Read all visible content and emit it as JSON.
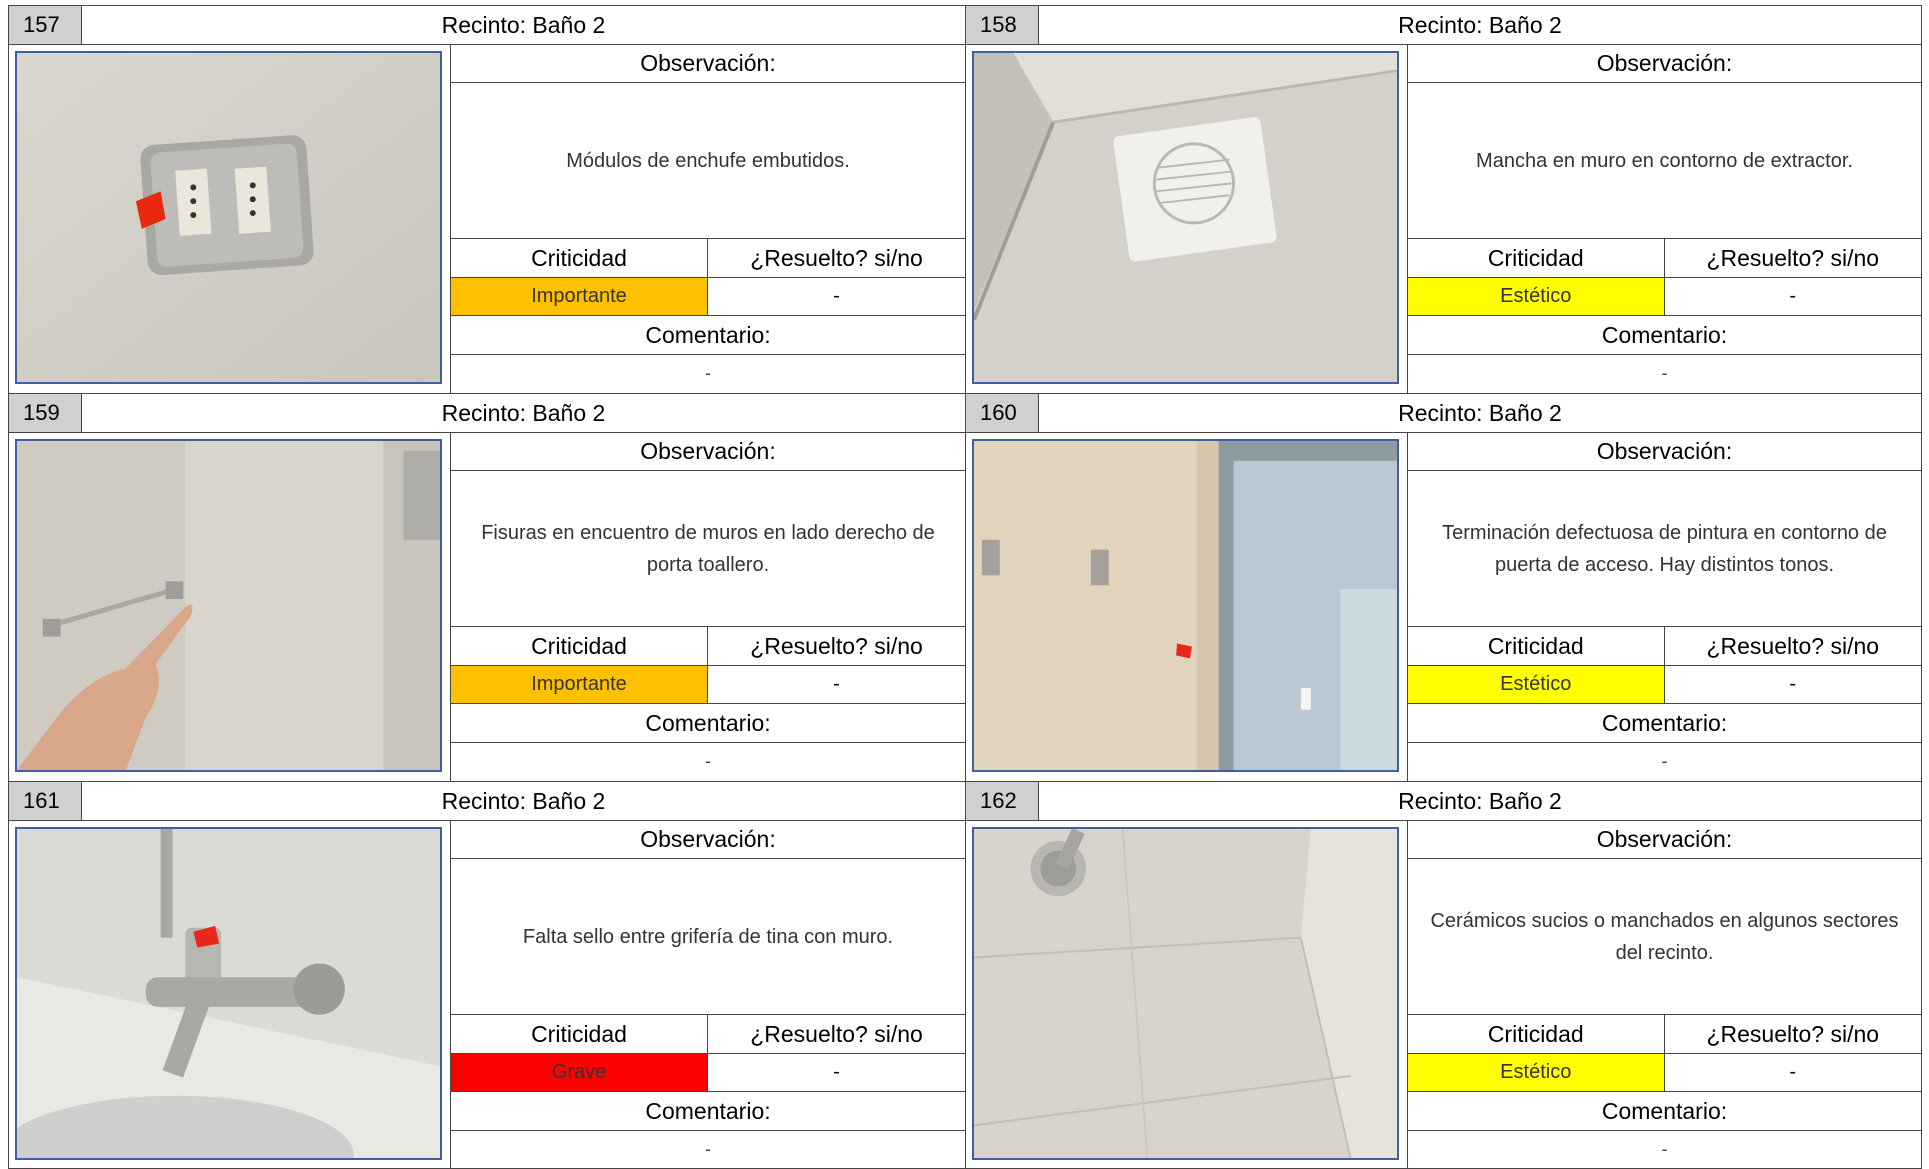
{
  "labels": {
    "observacion": "Observación:",
    "criticidad": "Criticidad",
    "resuelto": "¿Resuelto? si/no",
    "comentario": "Comentario:"
  },
  "severity_colors": {
    "Importante": "#ffc000",
    "Estético": "#ffff00",
    "Grave": "#ff0000"
  },
  "items": [
    {
      "number": "157",
      "recinto": "Recinto: Baño 2",
      "observation": "Módulos de enchufe embutidos.",
      "criticidad": "Importante",
      "resuelto": "-",
      "comentario": "-",
      "photo": "wall-socket"
    },
    {
      "number": "158",
      "recinto": "Recinto: Baño 2",
      "observation": "Mancha en muro en contorno de extractor.",
      "criticidad": "Estético",
      "resuelto": "-",
      "comentario": "-",
      "photo": "extractor-fan"
    },
    {
      "number": "159",
      "recinto": "Recinto: Baño 2",
      "observation": "Fisuras en encuentro de muros en lado derecho de porta toallero.",
      "criticidad": "Importante",
      "resuelto": "-",
      "comentario": "-",
      "photo": "towel-holder-hand"
    },
    {
      "number": "160",
      "recinto": "Recinto: Baño 2",
      "observation": "Terminación defectuosa de pintura en contorno de puerta de acceso. Hay distintos tonos.",
      "criticidad": "Estético",
      "resuelto": "-",
      "comentario": "-",
      "photo": "door-frame"
    },
    {
      "number": "161",
      "recinto": "Recinto: Baño 2",
      "observation": "Falta sello entre grifería de tina con muro.",
      "criticidad": "Grave",
      "resuelto": "-",
      "comentario": "-",
      "photo": "bath-faucet"
    },
    {
      "number": "162",
      "recinto": "Recinto: Baño 2",
      "observation": "Cerámicos sucios o manchados en algunos sectores del recinto.",
      "criticidad": "Estético",
      "resuelto": "-",
      "comentario": "-",
      "photo": "tiled-wall"
    }
  ]
}
